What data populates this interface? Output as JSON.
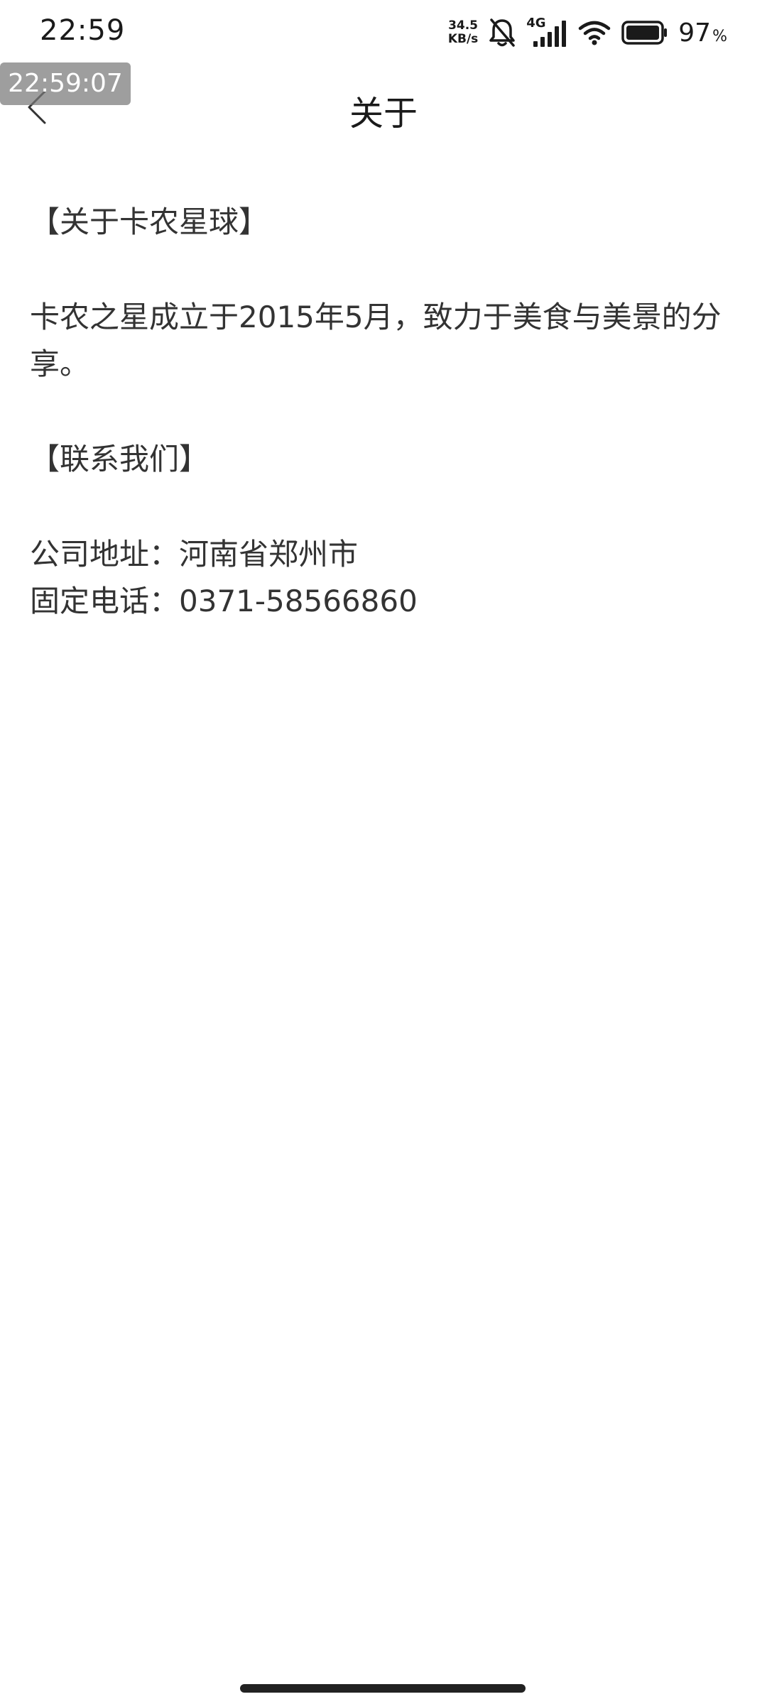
{
  "status_bar": {
    "time": "22:59",
    "net_speed_value": "34.5",
    "net_speed_unit": "KB/s",
    "network_type": "4G",
    "battery_level": "97",
    "battery_unit": "%",
    "icons": [
      "bell-muted-icon",
      "signal-icon",
      "wifi-icon",
      "battery-icon"
    ]
  },
  "overlay": {
    "timestamp": "22:59:07"
  },
  "header": {
    "title": "关于",
    "back_icon": "chevron-left-icon"
  },
  "content": {
    "about_heading": "【关于卡农星球】",
    "about_text": "卡农之星成立于2015年5月，致力于美食与美景的分享。",
    "contact_heading": "【联系我们】",
    "address_line": "公司地址：河南省郑州市",
    "phone_line": "固定电话：0371-58566860"
  }
}
